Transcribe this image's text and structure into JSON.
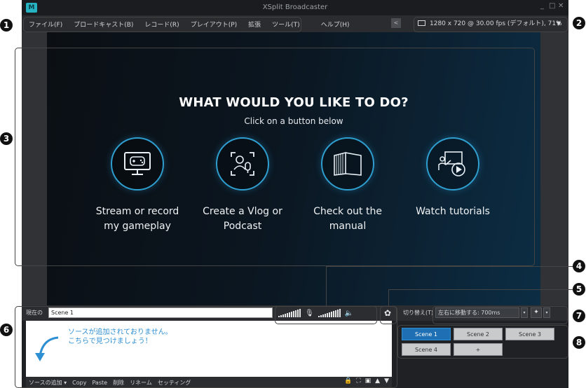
{
  "window": {
    "title": "XSplit Broadcaster",
    "minimize": "_",
    "maximize": "□",
    "close": "✕",
    "logo": "M"
  },
  "menu": {
    "items": [
      "ファイル(F)",
      "ブロードキャスト(B)",
      "レコード(R)",
      "プレイアウト(P)",
      "拡張",
      "ツール(T)",
      "ヘルプ(H)"
    ],
    "share_icon": "share-icon"
  },
  "resolution": {
    "text": "1280 x 720 @ 30.00 fps (デフォルト), 71%",
    "arrow": "▼"
  },
  "preview": {
    "headline": "WHAT WOULD YOU LIKE TO DO?",
    "subline": "Click on a button below",
    "options": [
      {
        "label_line1": "Stream or record",
        "label_line2": "my gameplay",
        "icon": "gamepad-monitor-icon"
      },
      {
        "label_line1": "Create a Vlog or",
        "label_line2": "Podcast",
        "icon": "person-mic-icon"
      },
      {
        "label_line1": "Check out the",
        "label_line2": "manual",
        "icon": "book-icon"
      },
      {
        "label_line1": "Watch tutorials",
        "label_line2": "",
        "icon": "presentation-play-icon"
      }
    ]
  },
  "status": {
    "scene_label": "現在の",
    "scene_value": "Scene 1",
    "transition_label": "切り替え(T)",
    "transition_value": "左右に移動する: 700ms",
    "dropdown_arrow": "▾",
    "gear": "✿",
    "fx": "✦"
  },
  "sources": {
    "empty_line1": "ソースが追加されておりません。",
    "empty_line2": "こちらで見つけましょう！",
    "toolbar": [
      "ソースの追加 ▾",
      "Copy",
      "Paste",
      "削除",
      "リネーム",
      "セッティング"
    ],
    "icons": [
      "🔒",
      "⛶",
      "▣",
      "▲",
      "▼"
    ]
  },
  "scenes": [
    "Scene 1",
    "Scene 2",
    "Scene 3",
    "Scene 4",
    "+"
  ],
  "callouts": [
    "1",
    "2",
    "3",
    "4",
    "5",
    "6",
    "7",
    "8"
  ],
  "colors": {
    "accent": "#2f8fd3",
    "scene_active": "#1f6fb4",
    "icon_ring": "#2f9fd0"
  }
}
